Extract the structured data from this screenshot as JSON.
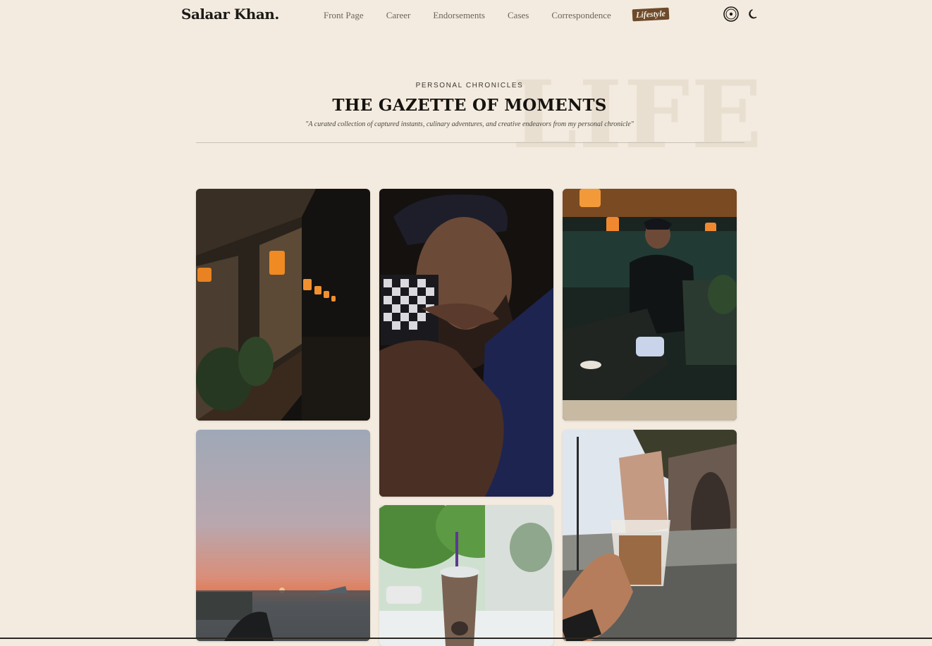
{
  "header": {
    "brand": "Salaar Khan.",
    "nav": [
      {
        "label": "Front Page"
      },
      {
        "label": "Career"
      },
      {
        "label": "Endorsements"
      },
      {
        "label": "Cases"
      },
      {
        "label": "Correspondence"
      },
      {
        "label": "Lifestyle",
        "active": true
      }
    ],
    "icons": [
      "record-icon",
      "moon-icon"
    ]
  },
  "hero": {
    "kicker": "PERSONAL CHRONICLES",
    "title": "THE GAZETTE OF MOMENTS",
    "tagline": "\"A curated collection of captured instants, culinary adventures, and creative endeavors from my personal chronicle\"",
    "watermark": "LIFE"
  },
  "colors": {
    "background": "#f3ebdf",
    "accent": "#6d4a2b"
  }
}
